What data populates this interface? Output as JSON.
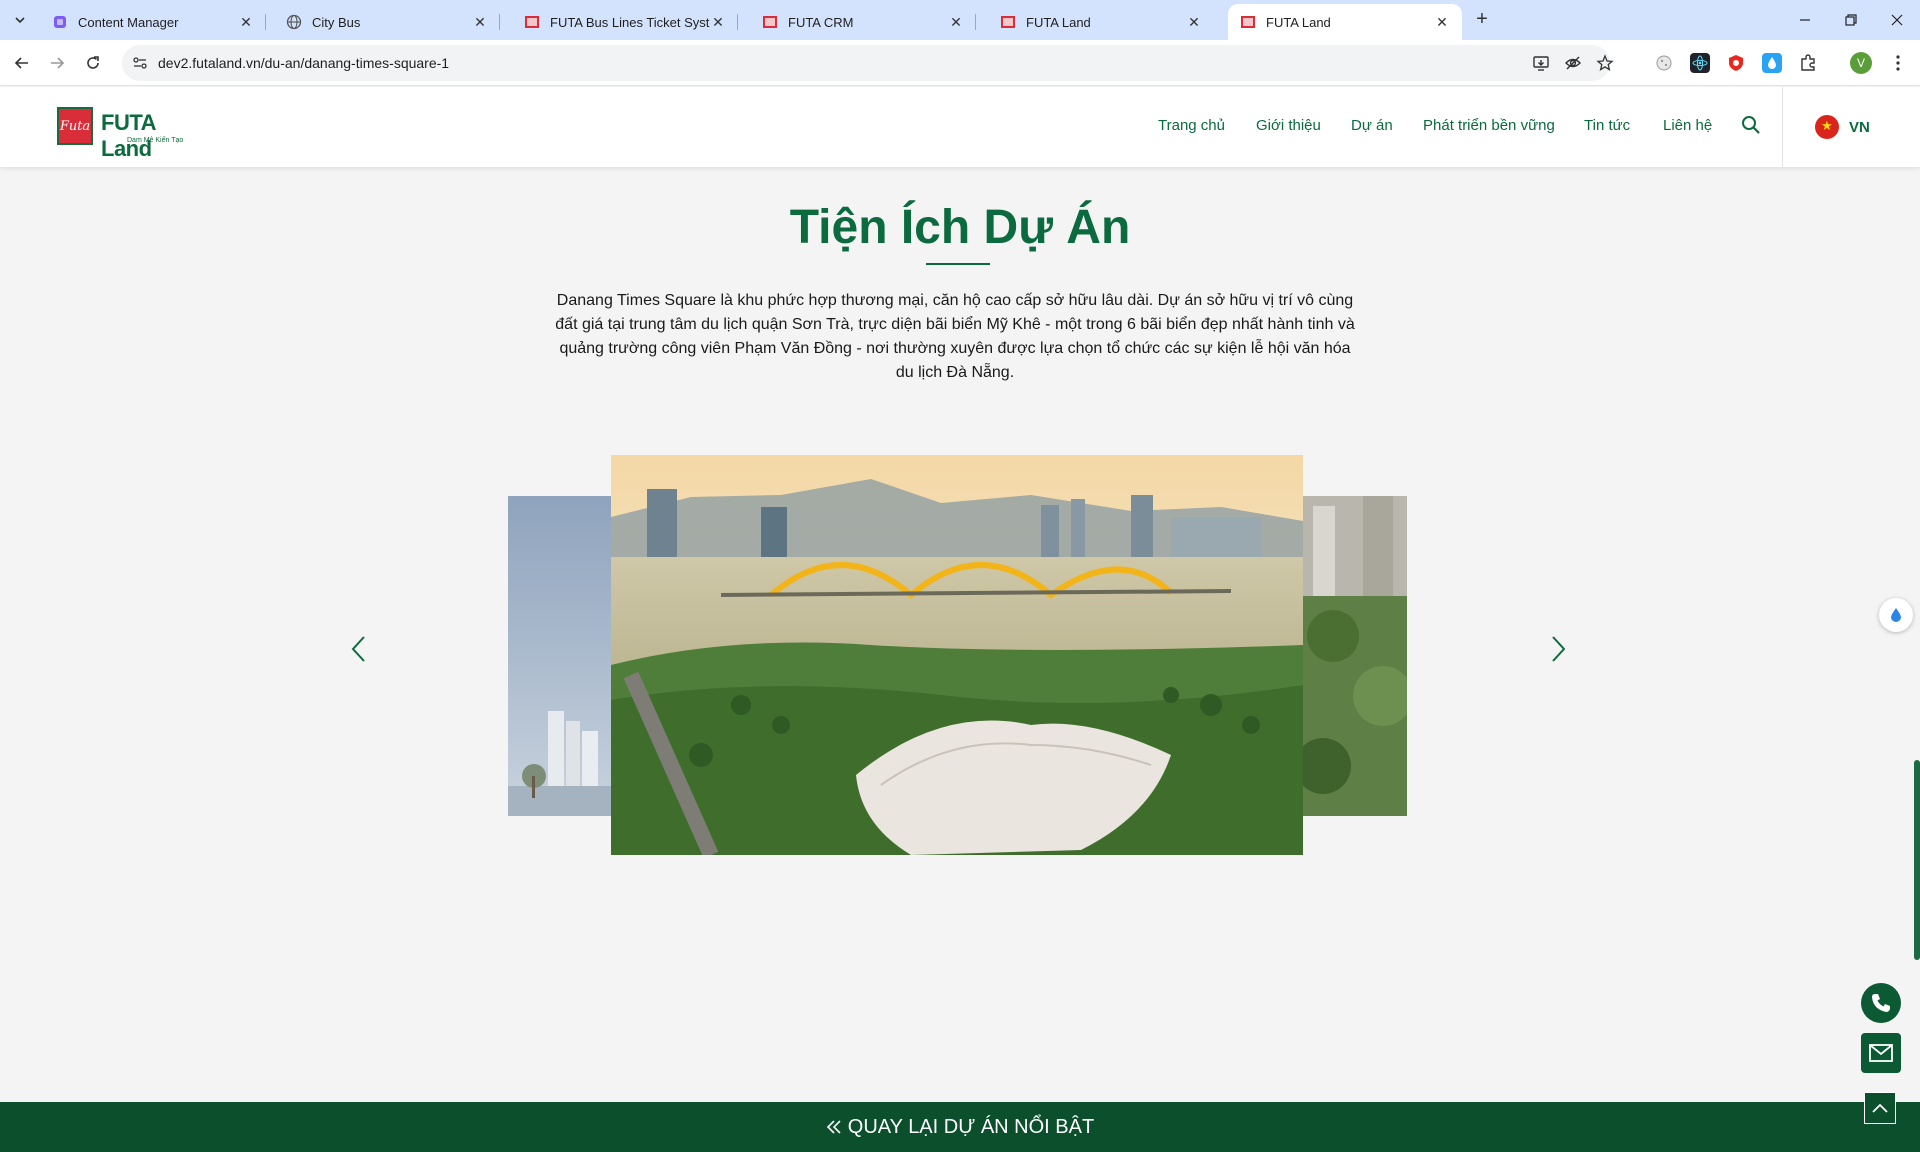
{
  "browser": {
    "tabs": [
      {
        "label": "Content Manager",
        "icon": "content-manager-favicon",
        "active": false
      },
      {
        "label": "City Bus",
        "icon": "globe-icon",
        "active": false
      },
      {
        "label": "FUTA Bus Lines Ticket System",
        "icon": "futa-favicon",
        "active": false
      },
      {
        "label": "FUTA CRM",
        "icon": "futa-favicon",
        "active": false
      },
      {
        "label": "FUTA Land",
        "icon": "futa-favicon",
        "active": false
      },
      {
        "label": "FUTA Land",
        "icon": "futa-favicon",
        "active": true
      }
    ],
    "url": "dev2.futaland.vn/du-an/danang-times-square-1",
    "profile_initial": "V"
  },
  "header": {
    "brand": {
      "name_a": "FUTA",
      "name_b": " Land",
      "mark": "Futa",
      "slogan": "Dam Mê Kiến Tạo"
    },
    "nav": [
      "Trang chủ",
      "Giới thiệu",
      "Dự án",
      "Phát triển bền vững",
      "Tin tức",
      "Liên hệ"
    ],
    "language": "VN"
  },
  "section": {
    "title": "Tiện Ích Dự Án",
    "description": "Danang Times Square là khu phức hợp thương mại, căn hộ cao cấp sở hữu lâu dài. Dự án sở hữu vị trí vô cùng đất giá tại trung tâm du lịch quận Sơn Trà, trực diện bãi biển Mỹ Khê - một trong 6 bãi biển đẹp nhất hành tinh và quảng trường công viên Phạm Văn Đồng - nơi thường xuyên được lựa chọn tổ chức các sự kiện lễ hội văn hóa du lịch Đà Nẵng."
  },
  "footer": {
    "back_label": "QUAY LẠI DỰ ÁN NỔI BẬT"
  },
  "colors": {
    "brand_green": "#0b6b3e",
    "footer_green": "#0b4f2c",
    "tabbar": "#d3e3fd",
    "brand_red": "#e01e2b"
  }
}
